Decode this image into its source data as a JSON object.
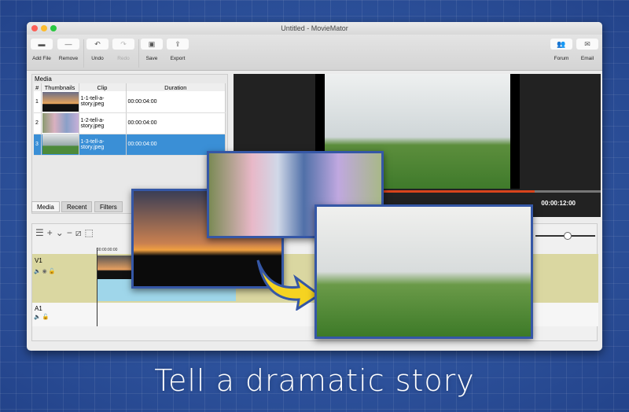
{
  "window": {
    "title": "Untitled - MovieMator"
  },
  "toolbar": {
    "add_file": "Add File",
    "remove": "Remove",
    "undo": "Undo",
    "redo": "Redo",
    "save": "Save",
    "export": "Export",
    "forum": "Forum",
    "email": "Email"
  },
  "media": {
    "title": "Media",
    "headers": [
      "#",
      "Thumbnails",
      "Clip",
      "Duration"
    ],
    "rows": [
      {
        "n": "1",
        "clip": "1-1-tell-a-story.jpeg",
        "duration": "00:00:04:00"
      },
      {
        "n": "2",
        "clip": "1-2-tell-a-story.jpeg",
        "duration": "00:00:04:00"
      },
      {
        "n": "3",
        "clip": "1-3-tell-a-story.jpeg",
        "duration": "00:00:04:00"
      }
    ],
    "selected_row": 3,
    "tabs": [
      "Media",
      "Recent",
      "Filters"
    ]
  },
  "preview": {
    "timecode": "00:00:12:00",
    "progress": 0.82
  },
  "timeline": {
    "ruler_start": "00:00:00:00",
    "tracks": [
      "V1",
      "A1"
    ]
  },
  "caption": "Tell a dramatic story",
  "colors": {
    "selection": "#3a8fd6",
    "progress": "#d9441c",
    "track_video": "#dad7a1",
    "clip": "#9fd6ea",
    "frame": "#3557a6",
    "arrow": "#f5d321"
  }
}
